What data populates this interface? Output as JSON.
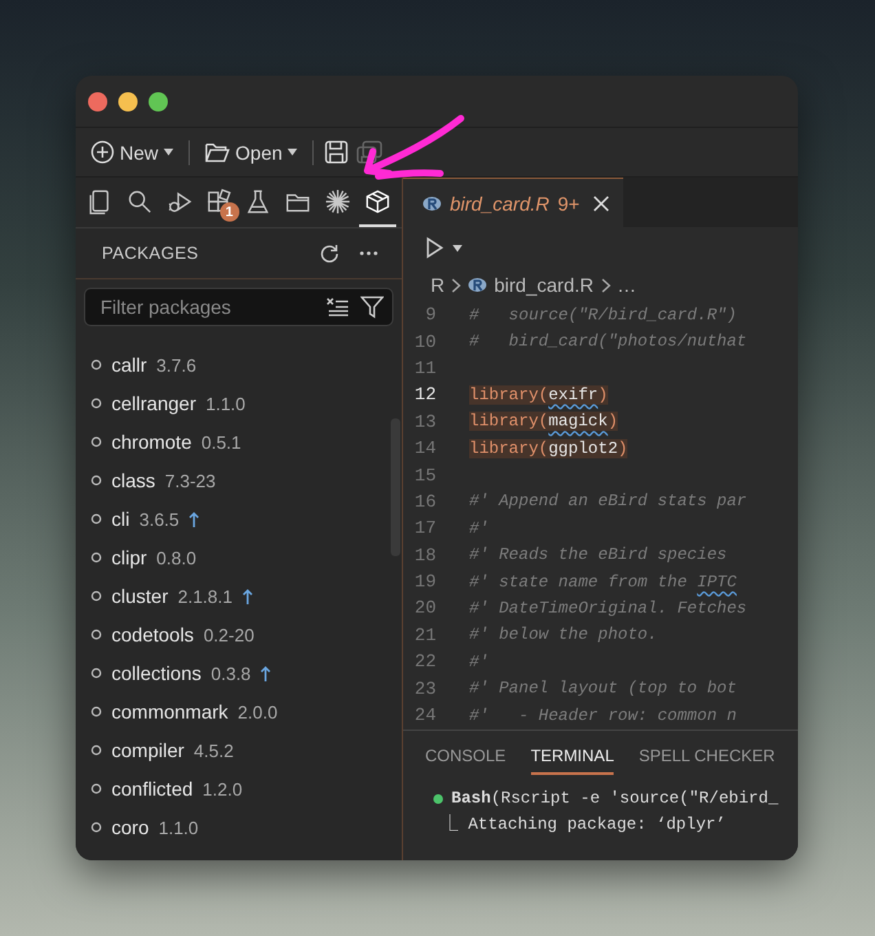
{
  "toolbar": {
    "new_label": "New",
    "open_label": "Open",
    "save_all_disabled": true
  },
  "activity_bar": [
    {
      "kind": "files",
      "selected": false
    },
    {
      "kind": "search",
      "selected": false
    },
    {
      "kind": "debug",
      "selected": false
    },
    {
      "kind": "extensions",
      "selected": false,
      "badge": "1"
    },
    {
      "kind": "flask",
      "selected": false
    },
    {
      "kind": "folder",
      "selected": false
    },
    {
      "kind": "burst",
      "selected": false
    },
    {
      "kind": "package",
      "selected": true
    }
  ],
  "sidebar": {
    "title": "PACKAGES",
    "filter": {
      "placeholder": "Filter packages"
    },
    "packages": [
      {
        "name": "callr",
        "version": "3.7.6",
        "update": false
      },
      {
        "name": "cellranger",
        "version": "1.1.0",
        "update": false
      },
      {
        "name": "chromote",
        "version": "0.5.1",
        "update": false
      },
      {
        "name": "class",
        "version": "7.3-23",
        "update": false
      },
      {
        "name": "cli",
        "version": "3.6.5",
        "update": true
      },
      {
        "name": "clipr",
        "version": "0.8.0",
        "update": false
      },
      {
        "name": "cluster",
        "version": "2.1.8.1",
        "update": true
      },
      {
        "name": "codetools",
        "version": "0.2-20",
        "update": false
      },
      {
        "name": "collections",
        "version": "0.3.8",
        "update": true
      },
      {
        "name": "commonmark",
        "version": "2.0.0",
        "update": false
      },
      {
        "name": "compiler",
        "version": "4.5.2",
        "update": false
      },
      {
        "name": "conflicted",
        "version": "1.2.0",
        "update": false
      },
      {
        "name": "coro",
        "version": "1.1.0",
        "update": false
      }
    ]
  },
  "editor": {
    "tab": {
      "name": "bird_card.R",
      "problems": "9+"
    },
    "breadcrumb": [
      "R",
      "bird_card.R",
      "…"
    ],
    "lines": [
      {
        "number": "9",
        "current": false,
        "highlighted": false,
        "segments": [
          {
            "kind": "comment",
            "text": "#   source(\"R/bird_card.R\")"
          }
        ]
      },
      {
        "number": "10",
        "current": false,
        "highlighted": false,
        "segments": [
          {
            "kind": "comment",
            "text": "#   bird_card(\"photos/nuthat"
          }
        ]
      },
      {
        "number": "11",
        "current": false,
        "highlighted": false
      },
      {
        "number": "12",
        "current": true,
        "highlighted": true,
        "segments": [
          {
            "kind": "function",
            "text": "library("
          },
          {
            "kind": "argument",
            "text": "exifr",
            "misspelled": true
          },
          {
            "kind": "function",
            "text": ")"
          }
        ]
      },
      {
        "number": "13",
        "current": false,
        "highlighted": true,
        "segments": [
          {
            "kind": "function",
            "text": "library("
          },
          {
            "kind": "argument",
            "text": "magick",
            "misspelled": true
          },
          {
            "kind": "function",
            "text": ")"
          }
        ]
      },
      {
        "number": "14",
        "current": false,
        "highlighted": true,
        "segments": [
          {
            "kind": "function",
            "text": "library("
          },
          {
            "kind": "argument",
            "text": "ggplot2"
          },
          {
            "kind": "function",
            "text": ")"
          }
        ]
      },
      {
        "number": "15",
        "current": false,
        "highlighted": false
      },
      {
        "number": "16",
        "current": false,
        "highlighted": false,
        "segments": [
          {
            "kind": "comment",
            "text": "#' Append an eBird stats par"
          }
        ]
      },
      {
        "number": "17",
        "current": false,
        "highlighted": false,
        "segments": [
          {
            "kind": "comment",
            "text": "#'"
          }
        ]
      },
      {
        "number": "18",
        "current": false,
        "highlighted": false,
        "segments": [
          {
            "kind": "comment",
            "text": "#' Reads the eBird species"
          }
        ]
      },
      {
        "number": "19",
        "current": false,
        "highlighted": false,
        "segments": [
          {
            "kind": "comment",
            "text": "#' state name from the "
          },
          {
            "kind": "comment",
            "text": "IPTC",
            "misspelled": true
          }
        ]
      },
      {
        "number": "20",
        "current": false,
        "highlighted": false,
        "segments": [
          {
            "kind": "comment",
            "text": "#' DateTimeOriginal. Fetches"
          }
        ]
      },
      {
        "number": "21",
        "current": false,
        "highlighted": false,
        "segments": [
          {
            "kind": "comment",
            "text": "#' below the photo."
          }
        ]
      },
      {
        "number": "22",
        "current": false,
        "highlighted": false,
        "segments": [
          {
            "kind": "comment",
            "text": "#'"
          }
        ]
      },
      {
        "number": "23",
        "current": false,
        "highlighted": false,
        "segments": [
          {
            "kind": "comment",
            "text": "#' Panel layout (top to bot"
          }
        ]
      },
      {
        "number": "24",
        "current": false,
        "highlighted": false,
        "segments": [
          {
            "kind": "comment",
            "text": "#'   - Header row: common n"
          }
        ]
      }
    ]
  },
  "panel": {
    "tabs": [
      {
        "label": "CONSOLE",
        "selected": false
      },
      {
        "label": "TERMINAL",
        "selected": true
      },
      {
        "label": "SPELL CHECKER",
        "selected": false
      }
    ],
    "terminal": [
      "**Bash**(Rscript -e 'source(\"R/ebird_",
      "⎿ Attaching package: ‘dplyr’"
    ]
  }
}
